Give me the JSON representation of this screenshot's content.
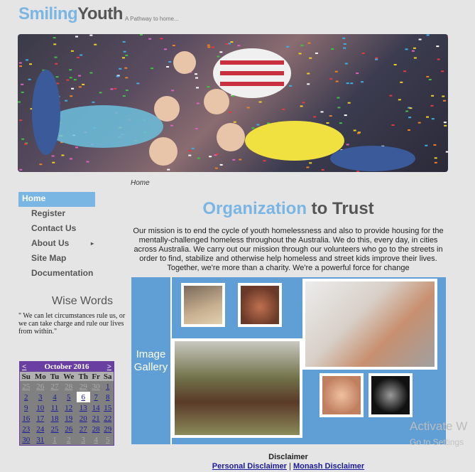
{
  "site": {
    "logo_a": "Smiling",
    "logo_b": "Youth",
    "tagline": "A Pathway to home..."
  },
  "breadcrumb": "Home",
  "nav": {
    "items": [
      {
        "label": "Home",
        "active": true
      },
      {
        "label": "Register"
      },
      {
        "label": "Contact Us"
      },
      {
        "label": "About Us",
        "arrow": "▸"
      },
      {
        "label": "Site Map"
      },
      {
        "label": "Documentation"
      }
    ]
  },
  "wise": {
    "title": "Wise Words",
    "text": "\" We can let circumstances rule us, or we can take charge and rule our lives from within.\""
  },
  "calendar": {
    "prev": "<",
    "next": ">",
    "title": "October 2016",
    "days": [
      "Su",
      "Mo",
      "Tu",
      "We",
      "Th",
      "Fr",
      "Sa"
    ],
    "weeks": [
      [
        "25",
        "26",
        "27",
        "28",
        "29",
        "30",
        "1"
      ],
      [
        "2",
        "3",
        "4",
        "5",
        "6",
        "7",
        "8"
      ],
      [
        "9",
        "10",
        "11",
        "12",
        "13",
        "14",
        "15"
      ],
      [
        "16",
        "17",
        "18",
        "19",
        "20",
        "21",
        "22"
      ],
      [
        "23",
        "24",
        "25",
        "26",
        "27",
        "28",
        "29"
      ],
      [
        "30",
        "31",
        "1",
        "2",
        "3",
        "4",
        "5"
      ]
    ],
    "today": "6"
  },
  "main": {
    "title_a": "Organization",
    "title_b": " to Trust",
    "mission": "Our mission is to end the cycle of youth homelessness and also to provide housing for the mentally-challenged homeless throughout the Australia. We do this, every day, in cities across Australia. We carry out our mission through our volunteers who go to the streets in order to find, stabilize and otherwise help homeless and street kids improve their lives. Together, we're more than a charity. We're a powerful force for change"
  },
  "gallery": {
    "label": "Image Gallery"
  },
  "footer": {
    "disclaimer": "Disclaimer",
    "link1": "Personal Disclaimer",
    "sep": " | ",
    "link2": "Monash Disclaimer"
  },
  "watermark": {
    "line1": "Activate W",
    "line2": "Go to Settings"
  }
}
